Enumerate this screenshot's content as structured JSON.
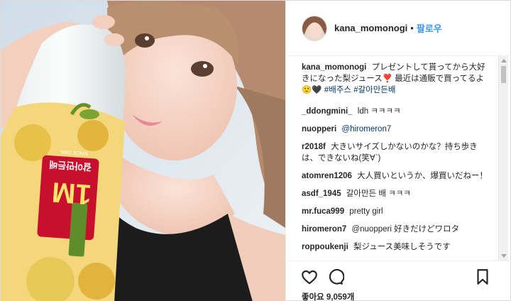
{
  "header": {
    "username": "kana_momonogi",
    "dot": "•",
    "follow_label": "팔로우"
  },
  "photo": {
    "bottle_label_main": "1M",
    "bottle_label_small": "갈아만든배",
    "bottle_label_top": "SINCE 1996"
  },
  "caption": {
    "username": "kana_momonogi",
    "text": "プレゼントして貰ってから大好きになった梨ジュース❣️ 最近は通販で買ってるよ🙂🖤",
    "tag1": "#배주스",
    "tag2": "#갈아만든배"
  },
  "comments": [
    {
      "user": "_ddongmini_",
      "text": "ldh ㅋㅋㅋㅋ"
    },
    {
      "user": "nuopperi",
      "text": "@hiromeron7"
    },
    {
      "user": "r2018f",
      "text": "大きいサイズしかないのかな？持ち歩きは、できないね(笑∀`)"
    },
    {
      "user": "atomren1206",
      "text": "大人買いというか、爆買いだねー！"
    },
    {
      "user": "asdf_1945",
      "text": "갈아만든 배 ㅋㅋㅋ"
    },
    {
      "user": "mr.fuca999",
      "text": "pretty girl"
    },
    {
      "user": "hiromeron7",
      "text": "@nuopperi 好きだけどワロタ"
    },
    {
      "user": "roppoukenji",
      "text": "梨ジュース美味しそうです"
    }
  ],
  "actions": {
    "likes": "좋아요 9,059개"
  },
  "icons": {
    "like": "heart-icon",
    "comment": "comment-icon",
    "save": "bookmark-icon"
  },
  "colors": {
    "link": "#3897f0",
    "hashtag": "#003569",
    "text": "#262626"
  }
}
